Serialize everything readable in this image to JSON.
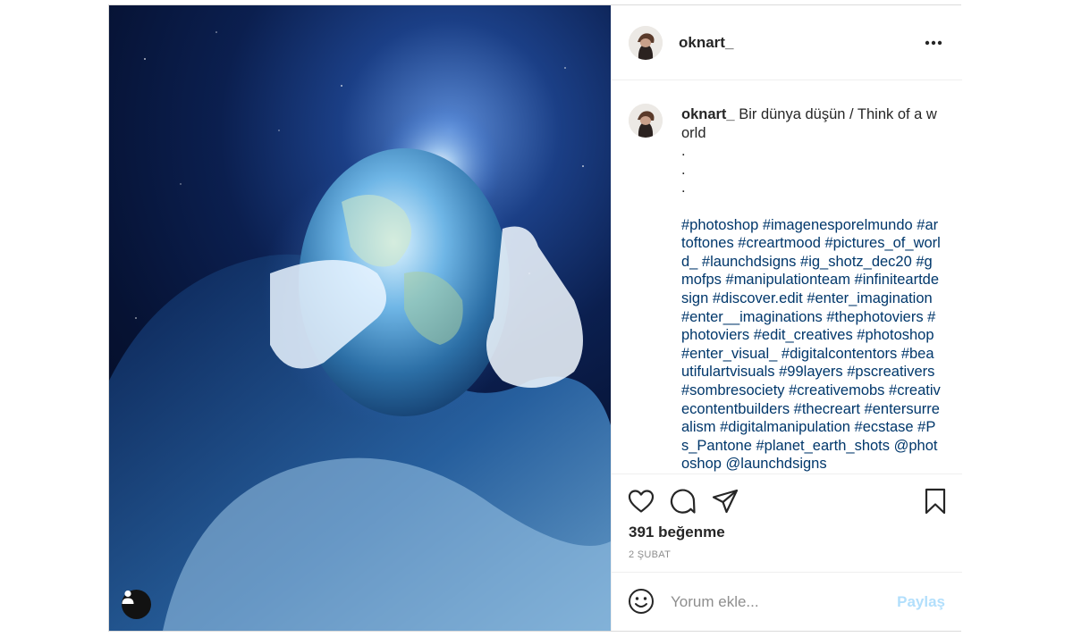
{
  "post": {
    "username": "oknart_",
    "caption": {
      "username": "oknart_",
      "text": " Bir dünya düşün / Think of a world\n.\n.\n.\n\n",
      "hashtags": "#photoshop #imagenesporelmundo #artoftones #creartmood #pictures_of_world_ #launchdsigns #ig_shotz_dec20 #gmofps #manipulationteam #infiniteartdesign #discover.edit #enter_imagination #enter__imaginations #thephotoviers #photoviers #edit_creatives #photoshop #enter_visual_ #digitalcontentors #beautifulartvisuals #99layers #pscreativers #sombresociety #creativemobs #creativecontentbuilders #thecreart #entersurrealism #digitalmanipulation #ecstase #Ps_Pantone #planet_earth_shots @photoshop @launchdsigns"
    },
    "likes": "391 beğenme",
    "date": "2 ŞUBAT"
  },
  "icons": {
    "more": "more-options-icon",
    "like": "heart-icon",
    "comment": "comment-icon",
    "share": "paper-plane-icon",
    "save": "bookmark-icon",
    "emoji": "smiley-icon",
    "user_tags": "user-icon"
  },
  "comment_box": {
    "placeholder": "Yorum ekle...",
    "post_label": "Paylaş"
  },
  "colors": {
    "hashtag": "#00376b",
    "post_button_disabled": "#b2dffc",
    "secondary_text": "#8e8e8e"
  }
}
